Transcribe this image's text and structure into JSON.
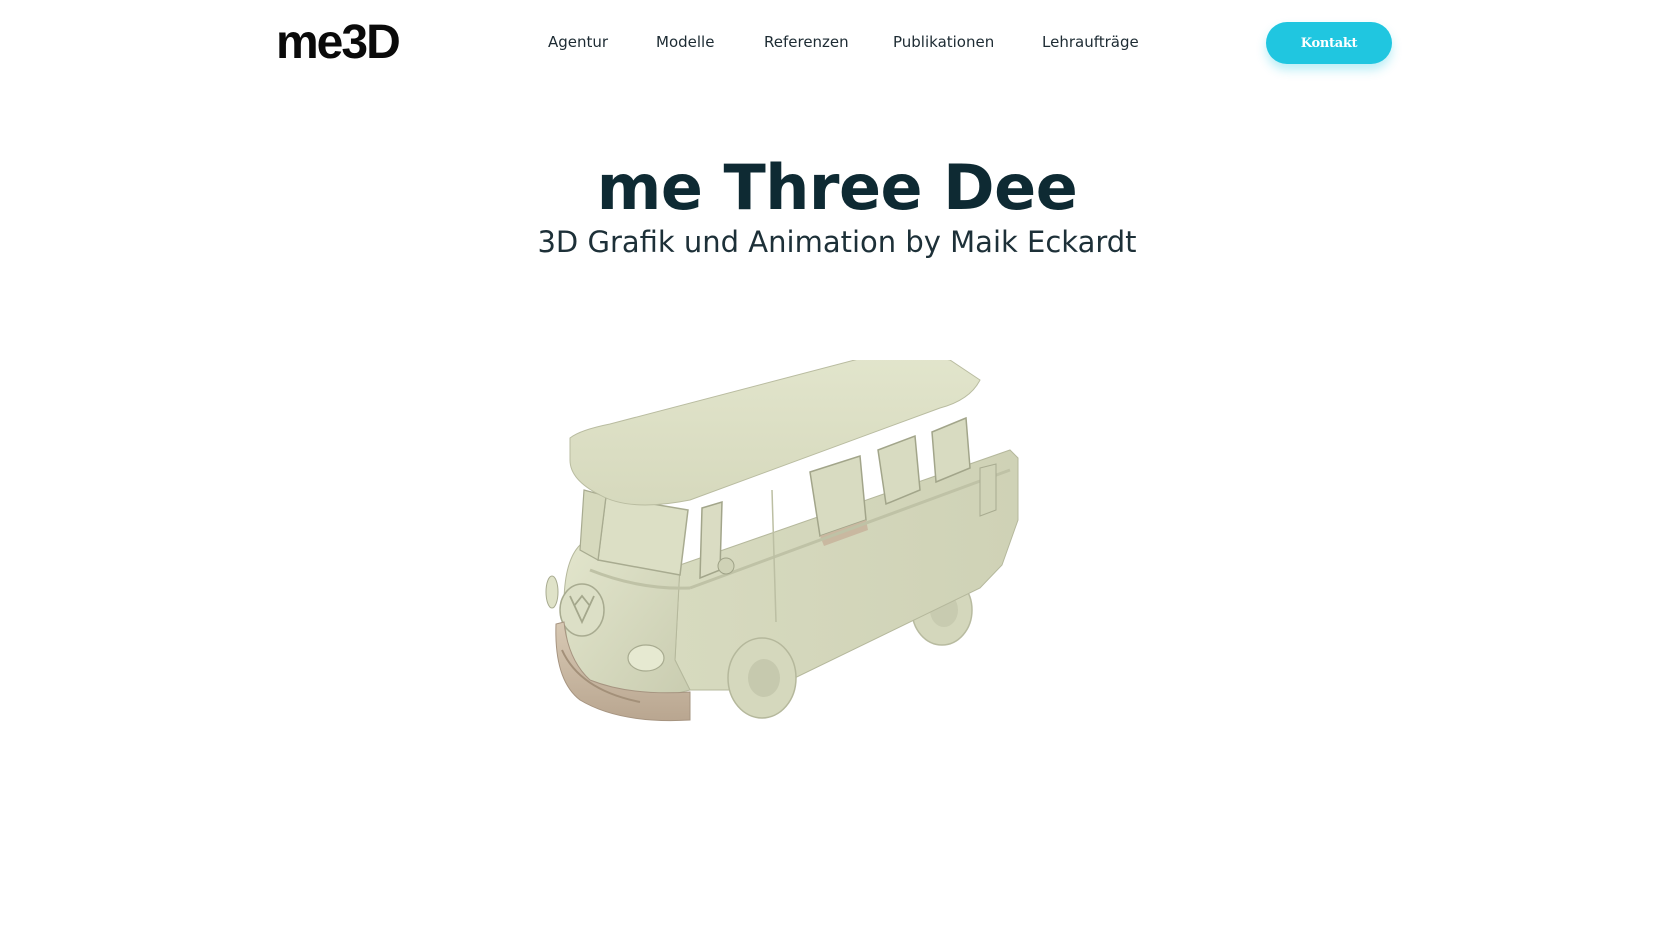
{
  "header": {
    "logo": "me3D",
    "nav": [
      {
        "label": "Agentur"
      },
      {
        "label": "Modelle"
      },
      {
        "label": "Referenzen"
      },
      {
        "label": "Publikationen"
      },
      {
        "label": "Lehraufträge"
      }
    ],
    "contact_label": "Kontakt"
  },
  "hero": {
    "title": "me Three Dee",
    "subtitle": "3D Grafik und Animation by Maik Eckardt"
  },
  "colors": {
    "accent": "#20c6e0",
    "heading": "#0e2a33",
    "model_body": "#d9dcc3"
  },
  "model": {
    "icon": "vw-bus-3d-model"
  }
}
